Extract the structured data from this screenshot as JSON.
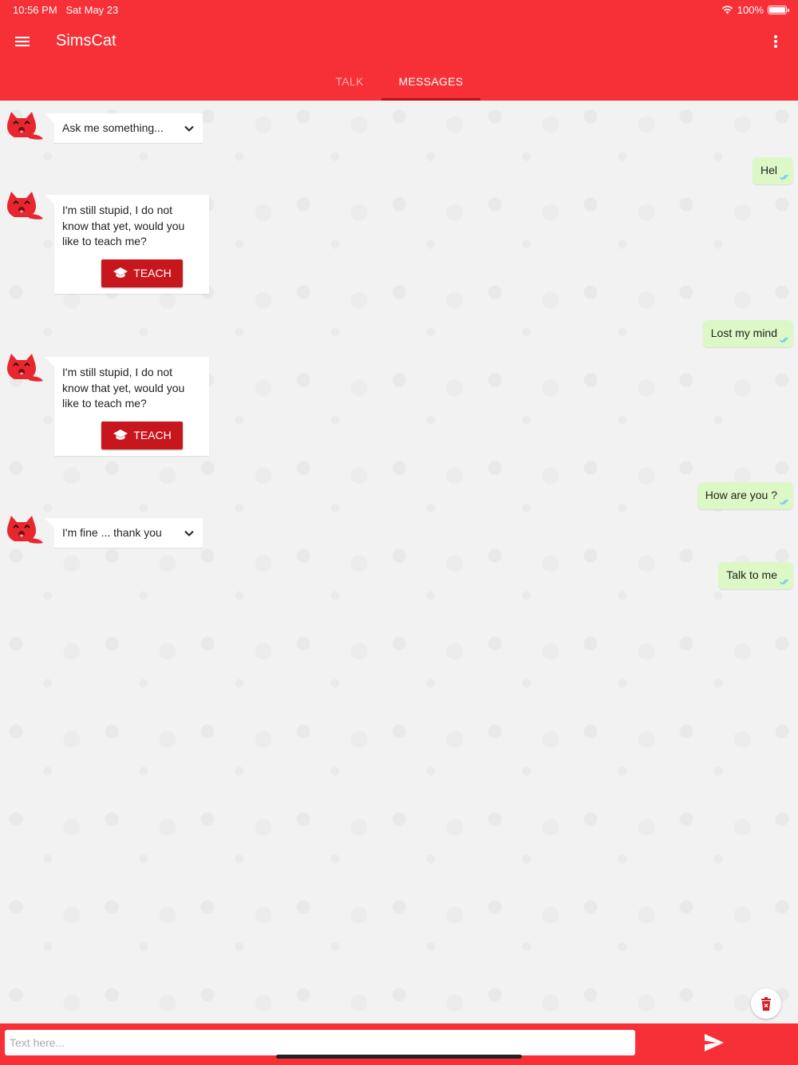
{
  "status_bar": {
    "time": "10:56 PM",
    "date": "Sat May 23",
    "battery": "100%"
  },
  "app_bar": {
    "title": "SimsCat",
    "menu_icon": "hamburger-menu-icon",
    "more_icon": "more-vert-icon"
  },
  "tabs": [
    {
      "label": "TALK",
      "active": false
    },
    {
      "label": "MESSAGES",
      "active": true
    }
  ],
  "messages": [
    {
      "from": "bot",
      "kind": "select",
      "text": "Ask me something..."
    },
    {
      "from": "user",
      "text": "Hel"
    },
    {
      "from": "bot",
      "kind": "text",
      "text": "I'm still stupid, I do not know that yet, would you like to teach me?",
      "button": "TEACH"
    },
    {
      "from": "user",
      "text": "Lost my mind"
    },
    {
      "from": "bot",
      "kind": "text",
      "text": "I'm still stupid, I do not know that yet, would you like to teach me?",
      "button": "TEACH"
    },
    {
      "from": "user",
      "text": "How are you ?"
    },
    {
      "from": "bot",
      "kind": "select",
      "text": "I'm fine ... thank you"
    },
    {
      "from": "user",
      "text": "Talk to me"
    }
  ],
  "input": {
    "placeholder": "Text here...",
    "value": ""
  },
  "colors": {
    "primary": "#f72f37",
    "accent_dark": "#c8161d",
    "user_bubble": "#dcf8c6",
    "read_check": "#4fc3f7"
  }
}
